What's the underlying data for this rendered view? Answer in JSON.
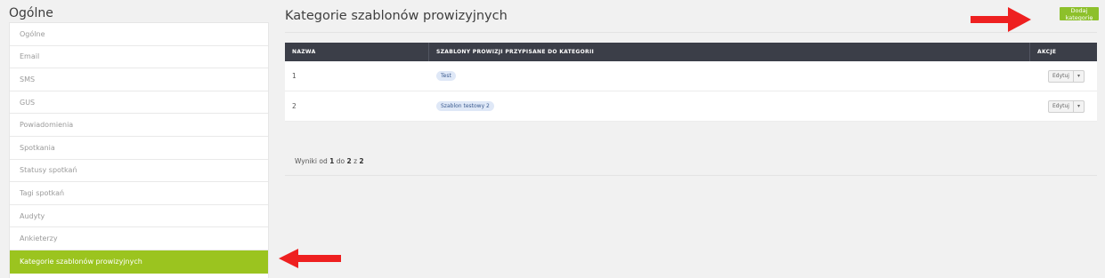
{
  "sidebar": {
    "title": "Ogólne",
    "items": [
      {
        "label": "Ogólne"
      },
      {
        "label": "Email"
      },
      {
        "label": "SMS"
      },
      {
        "label": "GUS"
      },
      {
        "label": "Powiadomienia"
      },
      {
        "label": "Spotkania"
      },
      {
        "label": "Statusy spotkań"
      },
      {
        "label": "Tagi spotkań"
      },
      {
        "label": "Audyty"
      },
      {
        "label": "Ankieterzy"
      },
      {
        "label": "Kategorie szablonów prowizyjnych",
        "active": true
      }
    ]
  },
  "main": {
    "title": "Kategorie szablonów prowizyjnych",
    "add_button": "Dodaj kategorię",
    "table": {
      "headers": [
        "NAZWA",
        "SZABLONY PROWIZJI PRZYPISANE DO KATEGORII",
        "AKCJE"
      ],
      "rows": [
        {
          "name": "1",
          "template": "Test",
          "action": "Edytuj"
        },
        {
          "name": "2",
          "template": "Szablon testowy 2",
          "action": "Edytuj"
        }
      ]
    },
    "results": {
      "prefix": "Wyniki od",
      "from": "1",
      "to_word": "do",
      "to": "2",
      "of_word": "z",
      "total": "2"
    }
  },
  "colors": {
    "accent": "#9bc41f",
    "button": "#8dc02b",
    "header": "#3b3e48",
    "arrow": "#ee2020"
  },
  "icons": {
    "arrow_left": "arrow-left-icon",
    "arrow_right": "arrow-right-icon",
    "caret": "chevron-down-icon"
  }
}
